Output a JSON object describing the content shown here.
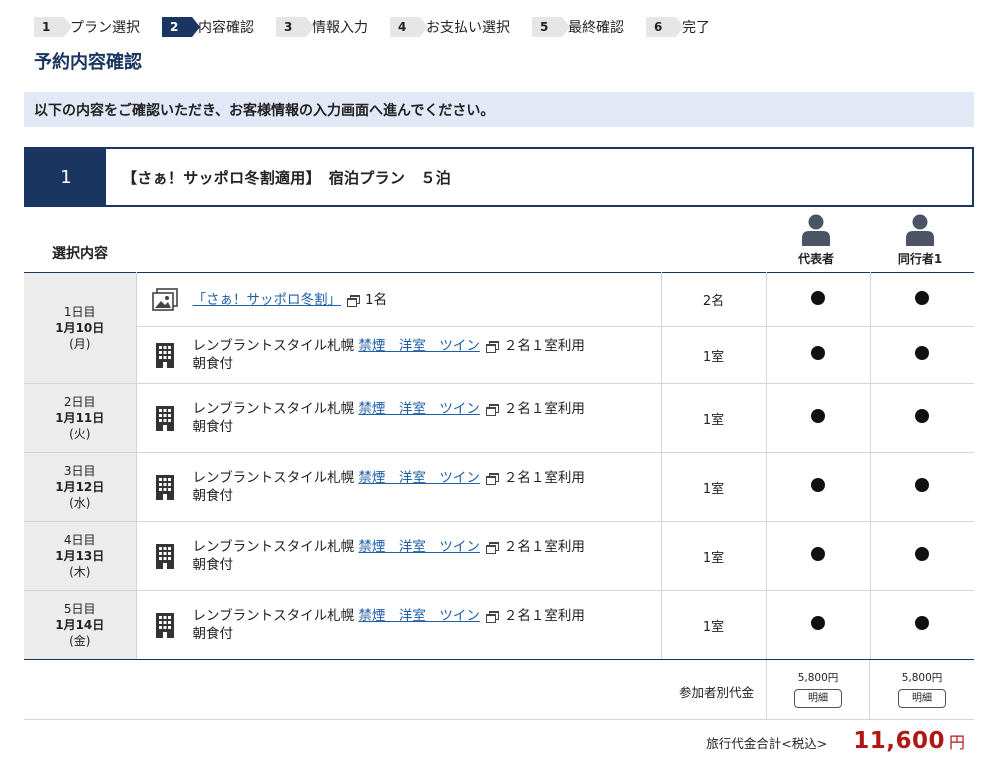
{
  "steps": [
    {
      "num": "1",
      "label": "プラン選択"
    },
    {
      "num": "2",
      "label": "内容確認"
    },
    {
      "num": "3",
      "label": "情報入力"
    },
    {
      "num": "4",
      "label": "お支払い選択"
    },
    {
      "num": "5",
      "label": "最終確認"
    },
    {
      "num": "6",
      "label": "完了"
    }
  ],
  "active_step": "2",
  "page_title": "予約内容確認",
  "notice": "以下の内容をご確認いただき、お客様情報の入力画面へ進んでください。",
  "plan": {
    "number": "1",
    "name": "【さぁ！サッポロ冬割適用】　宿泊プラン　５泊"
  },
  "selection_label": "選択内容",
  "persons": [
    "代表者",
    "同行者1"
  ],
  "days": [
    {
      "day": "1日目",
      "date": "1月10日",
      "weekday": "(月)"
    },
    {
      "day": "2日目",
      "date": "1月11日",
      "weekday": "(火)"
    },
    {
      "day": "3日目",
      "date": "1月12日",
      "weekday": "(水)"
    },
    {
      "day": "4日目",
      "date": "1月13日",
      "weekday": "(木)"
    },
    {
      "day": "5日目",
      "date": "1月14日",
      "weekday": "(金)"
    }
  ],
  "coupon": {
    "link": "「さぁ！サッポロ冬割」",
    "count": "1名",
    "qty": "2名"
  },
  "hotel": {
    "name": "レンブラントスタイル札幌",
    "room_link": "禁煙　洋室　ツイン",
    "usage": "２名１室利用",
    "meal": "朝食付",
    "qty": "1室"
  },
  "price_label": "参加者別代金",
  "prices": [
    "5,800円",
    "5,800円"
  ],
  "detail_button": "明細",
  "total_label": "旅行代金合計<税込>",
  "total_amount": "11,600",
  "total_unit": "円"
}
